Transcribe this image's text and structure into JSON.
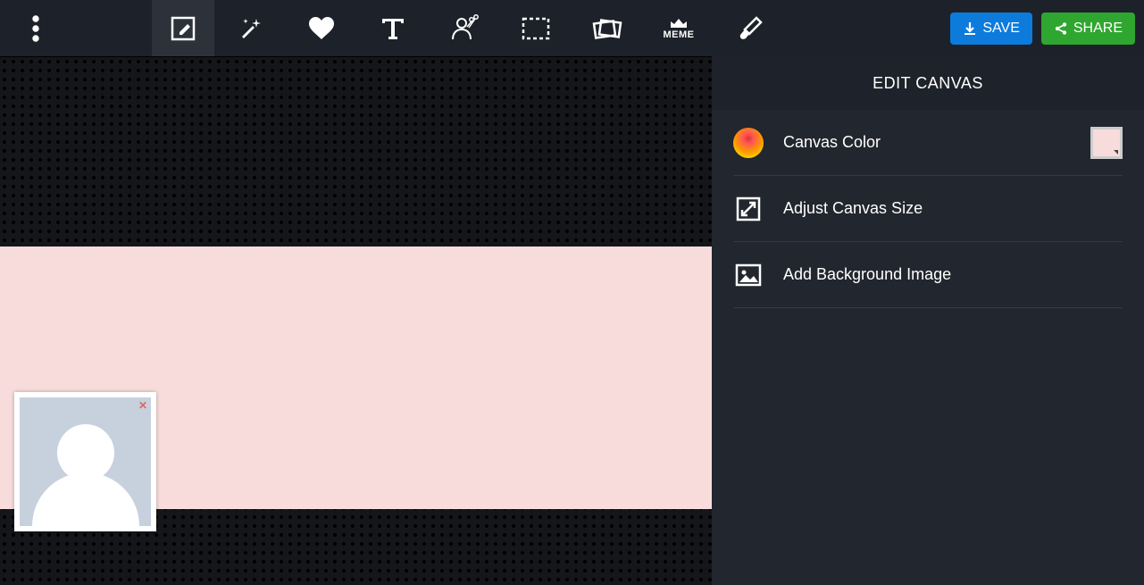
{
  "toolbar": {
    "meme_label": "MEME",
    "save_label": "SAVE",
    "share_label": "SHARE"
  },
  "sidebar": {
    "title": "EDIT CANVAS",
    "rows": {
      "canvas_color": "Canvas Color",
      "adjust_size": "Adjust Canvas Size",
      "add_bg": "Add Background Image"
    }
  },
  "canvas": {
    "color": "#f8dcdc"
  }
}
